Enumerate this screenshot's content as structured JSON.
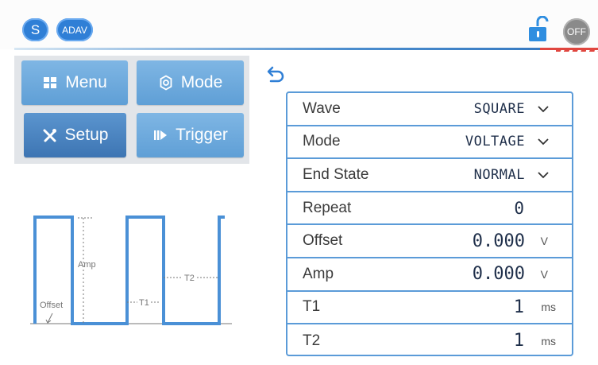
{
  "header": {
    "s_label": "S",
    "adav_label": "ADAV",
    "off_label": "OFF"
  },
  "buttons": {
    "menu": "Menu",
    "mode": "Mode",
    "setup": "Setup",
    "trigger": "Trigger"
  },
  "diagram": {
    "amp": "Amp",
    "offset": "Offset",
    "t1": "T1",
    "t2": "T2"
  },
  "params": {
    "wave": {
      "label": "Wave",
      "value": "SQUARE"
    },
    "mode": {
      "label": "Mode",
      "value": "VOLTAGE"
    },
    "end_state": {
      "label": "End State",
      "value": "NORMAL"
    },
    "repeat": {
      "label": "Repeat",
      "value": "0"
    },
    "offset": {
      "label": "Offset",
      "value": "0.000",
      "unit": "V"
    },
    "amp": {
      "label": "Amp",
      "value": "0.000",
      "unit": "V"
    },
    "t1": {
      "label": "T1",
      "value": "1",
      "unit": "ms"
    },
    "t2": {
      "label": "T2",
      "value": "1",
      "unit": "ms"
    }
  },
  "colors": {
    "accent": "#5b9bd8",
    "button": "#6aa8dc",
    "button_active": "#4a83c2",
    "lock": "#2f8ee0",
    "alert": "#e0463f"
  }
}
